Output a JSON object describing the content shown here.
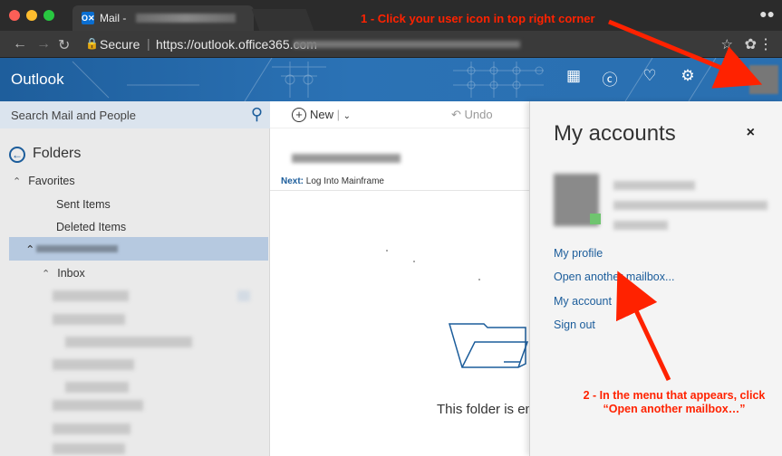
{
  "browser": {
    "tab_title": "Mail -",
    "tab_icon": "O✕",
    "secure_label": "Secure",
    "url": "https://outlook.office365.com",
    "icons": [
      "close-dot-icon",
      "minimize-dot-icon",
      "maximize-dot-icon",
      "back-icon",
      "forward-icon",
      "reload-icon",
      "lock-icon",
      "star-icon",
      "extension-icon",
      "kebab-icon",
      "incognito-icon"
    ]
  },
  "header": {
    "brand": "Outlook",
    "icons": [
      "app-launcher-icon",
      "skype-icon",
      "bell-icon",
      "gear-icon",
      "help-icon"
    ]
  },
  "left": {
    "search_placeholder": "Search Mail and People",
    "folders_label": "Folders",
    "favorites_label": "Favorites",
    "sent_items": "Sent Items",
    "deleted_items": "Deleted Items",
    "inbox_label": "Inbox"
  },
  "middle": {
    "new_label": "New",
    "undo_label": "Undo",
    "next_label": "Next:",
    "next_value": "Log Into Mainframe",
    "empty_text": "This folder is em"
  },
  "panel": {
    "title": "My accounts",
    "close": "×",
    "links": [
      "My profile",
      "Open another mailbox...",
      "My account",
      "Sign out"
    ]
  },
  "annotations": {
    "step1": "1 - Click your user icon in top right corner",
    "step2_line1": "2 - In the menu that appears, click",
    "step2_line2": "“Open another mailbox…”"
  },
  "colors": {
    "outlook_blue": "#1c5d9b",
    "annotation_red": "#ff2200",
    "selected_row": "#b6c9e0",
    "status_green": "#6fc46f"
  }
}
